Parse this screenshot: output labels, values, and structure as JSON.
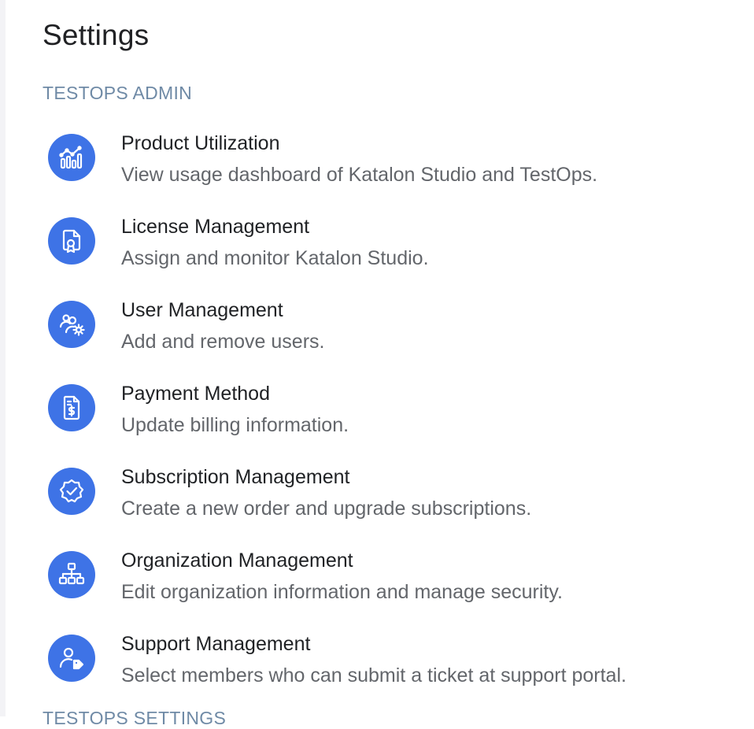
{
  "page": {
    "title": "Settings"
  },
  "sections": {
    "admin_header": "TESTOPS ADMIN",
    "next_header": "TESTOPS SETTINGS"
  },
  "items": [
    {
      "title": "Product Utilization",
      "description": "View usage dashboard of Katalon Studio and TestOps.",
      "icon": "analytics-chart-icon"
    },
    {
      "title": "License Management",
      "description": "Assign and monitor Katalon Studio.",
      "icon": "license-certificate-icon"
    },
    {
      "title": "User Management",
      "description": "Add and remove users.",
      "icon": "users-gear-icon"
    },
    {
      "title": "Payment Method",
      "description": "Update billing information.",
      "icon": "invoice-dollar-icon"
    },
    {
      "title": "Subscription Management",
      "description": "Create a new order and upgrade subscriptions.",
      "icon": "verified-badge-icon"
    },
    {
      "title": "Organization Management",
      "description": "Edit organization information and manage security.",
      "icon": "org-chart-icon"
    },
    {
      "title": "Support Management",
      "description": "Select members who can submit a ticket at support portal.",
      "icon": "user-tag-icon"
    }
  ],
  "colors": {
    "accent": "#3e73e6",
    "section_header": "#6f8aa6",
    "title_text": "#1f2124",
    "description_text": "#63666b"
  }
}
